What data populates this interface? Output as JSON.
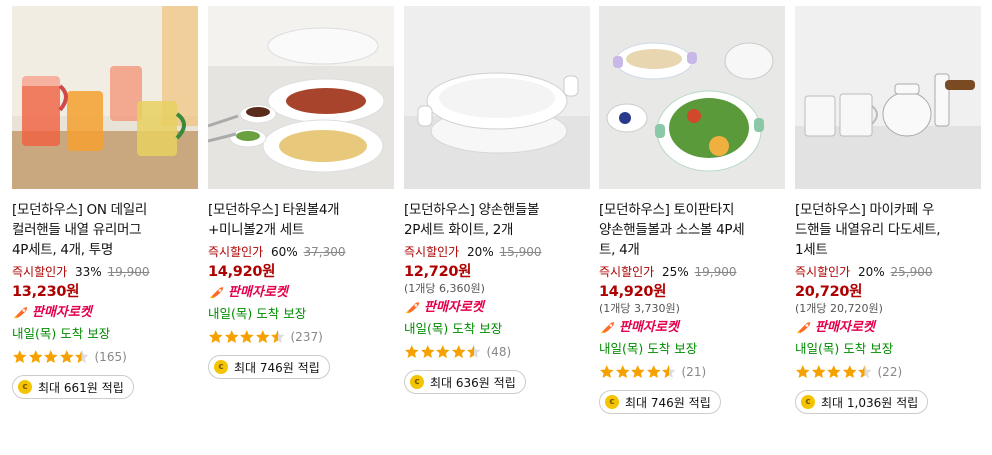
{
  "colors": {
    "discount_label": "#ae0000",
    "price": "#ae0000",
    "rocket": "#e4004a",
    "arrival": "#008c00",
    "star": "#f5a100",
    "coin": "#f5c400"
  },
  "products": [
    {
      "title_lines": [
        "[모던하우스] ON 데일리",
        "컬러핸들 내열 유리머그",
        "4P세트, 4개, 투명"
      ],
      "discount_label": "즉시할인가",
      "discount_pct": "33%",
      "original_price": "19,900",
      "price": "13,230원",
      "unit_price": "",
      "rocket_label": "판매자로켓",
      "arrival": "내일(목) 도착 보장",
      "rating": 4.5,
      "review_count": "(165)",
      "reward": "최대 661원 적립",
      "image_icon": "glass-mugs-image"
    },
    {
      "title_lines": [
        "[모던하우스] 타원볼4개",
        "+미니볼2개 세트"
      ],
      "discount_label": "즉시할인가",
      "discount_pct": "60%",
      "original_price": "37,300",
      "price": "14,920원",
      "unit_price": "",
      "rocket_label": "판매자로켓",
      "arrival": "내일(목) 도착 보장",
      "rating": 4.5,
      "review_count": "(237)",
      "reward": "최대 746원 적립",
      "image_icon": "oval-bowls-image"
    },
    {
      "title_lines": [
        "[모던하우스] 양손핸들볼",
        "2P세트 화이트, 2개"
      ],
      "discount_label": "즉시할인가",
      "discount_pct": "20%",
      "original_price": "15,900",
      "price": "12,720원",
      "unit_price": "(1개당 6,360원)",
      "rocket_label": "판매자로켓",
      "arrival": "내일(목) 도착 보장",
      "rating": 4.5,
      "review_count": "(48)",
      "reward": "최대 636원 적립",
      "image_icon": "handle-bowls-image"
    },
    {
      "title_lines": [
        "[모던하우스] 토이판타지",
        "양손핸들볼과 소스볼 4P세",
        "트, 4개"
      ],
      "discount_label": "즉시할인가",
      "discount_pct": "25%",
      "original_price": "19,900",
      "price": "14,920원",
      "unit_price": "(1개당 3,730원)",
      "rocket_label": "판매자로켓",
      "arrival": "내일(목) 도착 보장",
      "rating": 4.5,
      "review_count": "(21)",
      "reward": "최대 746원 적립",
      "image_icon": "salad-bowls-image"
    },
    {
      "title_lines": [
        "[모던하우스] 마이카페 우",
        "드핸들 내열유리 다도세트,",
        "1세트"
      ],
      "discount_label": "즉시할인가",
      "discount_pct": "20%",
      "original_price": "25,900",
      "price": "20,720원",
      "unit_price": "(1개당 20,720원)",
      "rocket_label": "판매자로켓",
      "arrival": "내일(목) 도착 보장",
      "rating": 4.5,
      "review_count": "(22)",
      "reward": "최대 1,036원 적립",
      "image_icon": "tea-set-image"
    }
  ]
}
